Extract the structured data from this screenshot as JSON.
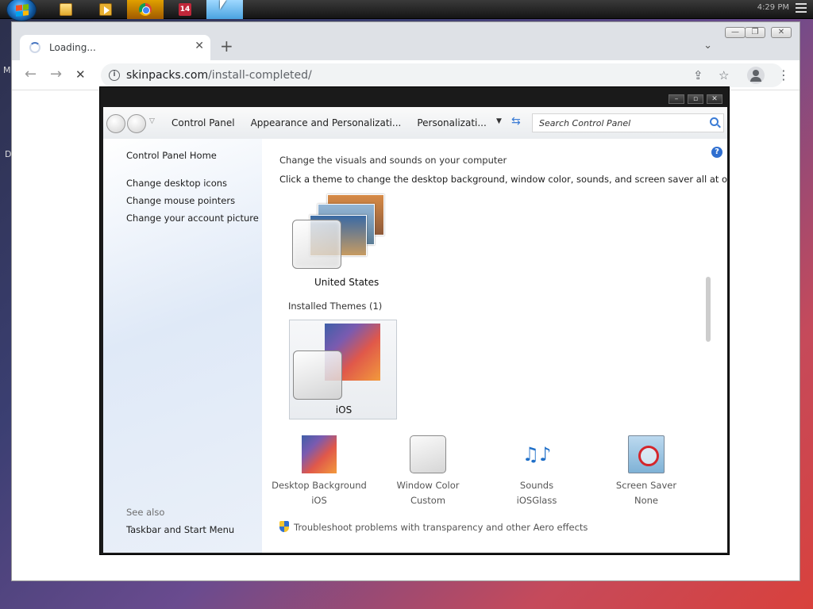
{
  "taskbar": {
    "calendar_day": "14",
    "clock": "4:29 PM"
  },
  "desktop": {
    "letter_top": "M",
    "letter_mid": "D"
  },
  "browser": {
    "tab": {
      "title": "Loading...",
      "close": "✕"
    },
    "new_tab": "+",
    "tab_dropdown": "⌄",
    "nav": {
      "back": "←",
      "forward": "→",
      "stop": "✕"
    },
    "url": {
      "host": "skinpacks.com",
      "path": "/install-completed/"
    },
    "window_controls": {
      "minimize": "—",
      "maximize": "❐",
      "close": "✕"
    },
    "icons": {
      "share": "⇪",
      "star": "☆",
      "menu": "⋮"
    }
  },
  "control_panel": {
    "window_controls": {
      "minimize": "–",
      "maximize": "▫",
      "close": "✕"
    },
    "breadcrumb": [
      "Control Panel",
      "Appearance and Personalizati...",
      "Personalizati..."
    ],
    "search_placeholder": "Search Control Panel",
    "sidebar": {
      "home": "Control Panel Home",
      "links": [
        "Change desktop icons",
        "Change mouse pointers",
        "Change your account picture"
      ],
      "see_also_title": "See also",
      "see_also_links": [
        "Taskbar and Start Menu"
      ]
    },
    "main": {
      "heading": "Change the visuals and sounds on your computer",
      "subheading": "Click a theme to change the desktop background, window color, sounds, and screen saver all at once.",
      "themes": [
        {
          "name": "United States"
        }
      ],
      "installed_title": "Installed Themes (1)",
      "installed_themes": [
        {
          "name": "iOS",
          "selected": true
        }
      ],
      "bottom": [
        {
          "label": "Desktop Background",
          "value": "iOS"
        },
        {
          "label": "Window Color",
          "value": "Custom"
        },
        {
          "label": "Sounds",
          "value": "iOSGlass"
        },
        {
          "label": "Screen Saver",
          "value": "None"
        }
      ],
      "troubleshoot": "Troubleshoot problems with transparency and other Aero effects"
    }
  },
  "colors": {
    "accent": "#2f6fd0",
    "sidebar_bg": "#dfe9f7"
  }
}
